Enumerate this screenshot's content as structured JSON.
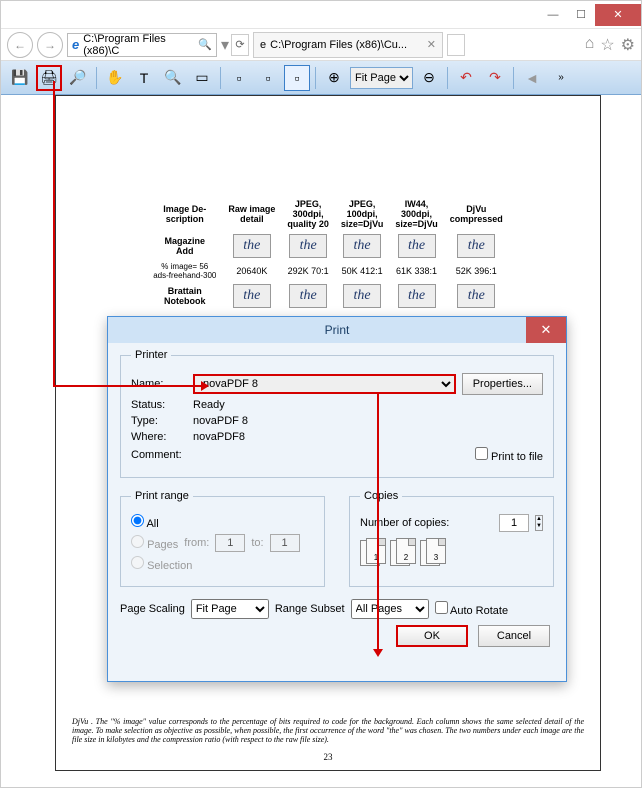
{
  "window": {
    "url_short": "C:\\Program Files (x86)\\C",
    "tab_title": "C:\\Program Files (x86)\\Cu..."
  },
  "toolbar": {
    "zoom_label": "Fit Page"
  },
  "doc": {
    "headers": [
      "Image De-\nscription",
      "Raw image\ndetail",
      "JPEG,\n300dpi,\nquality 20",
      "JPEG,\n100dpi,\nsize=DjVu",
      "IW44,\n300dpi,\nsize=DjVu",
      "DjVu\ncompressed"
    ],
    "row1_label": "Magazine\nAdd",
    "row1_meta": "% image= 56\nads-freehand-300",
    "row1_vals": [
      "the",
      "the",
      "the",
      "the",
      "the",
      "the"
    ],
    "row1_sizes": [
      "20640K",
      "292K 70:1",
      "50K 412:1",
      "61K 338:1",
      "52K 396:1"
    ],
    "row2_label": "Brattain\nNotebook",
    "row2_vals": [
      "the",
      "the",
      "the",
      "the",
      "the",
      "the"
    ],
    "caption": "DjVu . The \"% image\" value corresponds to the percentage of bits required to code for the background. Each column shows the same selected detail of the image. To make selection as objective as possible, when possible, the first occurrence of the word \"the\" was chosen. The two numbers under each image are the file size in kilobytes and the compression ratio (with respect to the raw file size).",
    "page_number": "23"
  },
  "dialog": {
    "title": "Print",
    "printer_legend": "Printer",
    "name_lbl": "Name:",
    "name_value": "novaPDF 8",
    "properties": "Properties...",
    "status_lbl": "Status:",
    "status_val": "Ready",
    "type_lbl": "Type:",
    "type_val": "novaPDF 8",
    "where_lbl": "Where:",
    "where_val": "novaPDF8",
    "comment_lbl": "Comment:",
    "print_to_file": "Print to file",
    "range_legend": "Print range",
    "opt_all": "All",
    "opt_pages": "Pages",
    "from_lbl": "from:",
    "from_v": "1",
    "to_lbl": "to:",
    "to_v": "1",
    "opt_selection": "Selection",
    "copies_legend": "Copies",
    "copies_lbl": "Number of copies:",
    "copies_v": "1",
    "scaling_lbl": "Page Scaling",
    "scaling_v": "Fit Page",
    "subset_lbl": "Range Subset",
    "subset_v": "All Pages",
    "auto_rotate": "Auto Rotate",
    "ok": "OK",
    "cancel": "Cancel"
  }
}
